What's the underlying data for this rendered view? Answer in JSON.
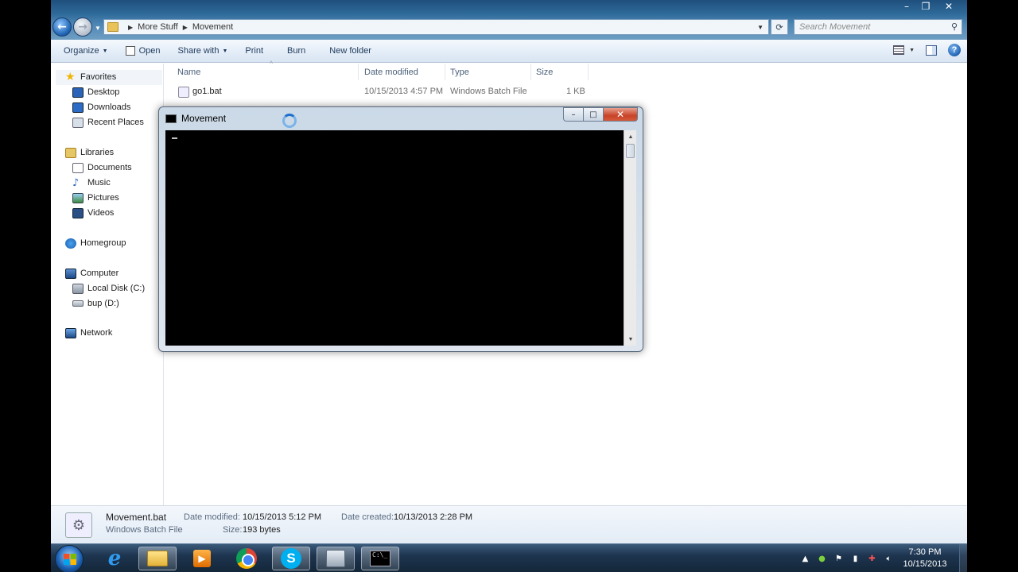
{
  "address": {
    "crumbs": [
      "More Stuff",
      "Movement"
    ]
  },
  "search": {
    "placeholder": "Search Movement"
  },
  "toolbar": {
    "organize": "Organize",
    "open": "Open",
    "share_with": "Share with",
    "print": "Print",
    "burn": "Burn",
    "new_folder": "New folder"
  },
  "nav": {
    "favorites": "Favorites",
    "desktop": "Desktop",
    "downloads": "Downloads",
    "recent_places": "Recent Places",
    "libraries": "Libraries",
    "documents": "Documents",
    "music": "Music",
    "pictures": "Pictures",
    "videos": "Videos",
    "homegroup": "Homegroup",
    "computer": "Computer",
    "local_disk": "Local Disk (C:)",
    "bup": "bup (D:)",
    "network": "Network"
  },
  "columns": {
    "name": "Name",
    "date_modified": "Date modified",
    "type": "Type",
    "size": "Size"
  },
  "files": [
    {
      "name": "go1.bat",
      "date": "10/15/2013 4:57 PM",
      "type": "Windows Batch File",
      "size": "1 KB"
    }
  ],
  "console": {
    "title": "Movement"
  },
  "details": {
    "filename": "Movement.bat",
    "filetype": "Windows Batch File",
    "date_modified_label": "Date modified:",
    "date_modified_value": "10/15/2013 5:12 PM",
    "size_label": "Size:",
    "size_value": "193 bytes",
    "date_created_label": "Date created:",
    "date_created_value": "10/13/2013 2:28 PM"
  },
  "taskbar": {
    "time": "7:30 PM",
    "date": "10/15/2013"
  },
  "colors": {
    "accent": "#1e395b",
    "title_bar": "#2e6a9a",
    "taskbar": "#1e3550"
  }
}
